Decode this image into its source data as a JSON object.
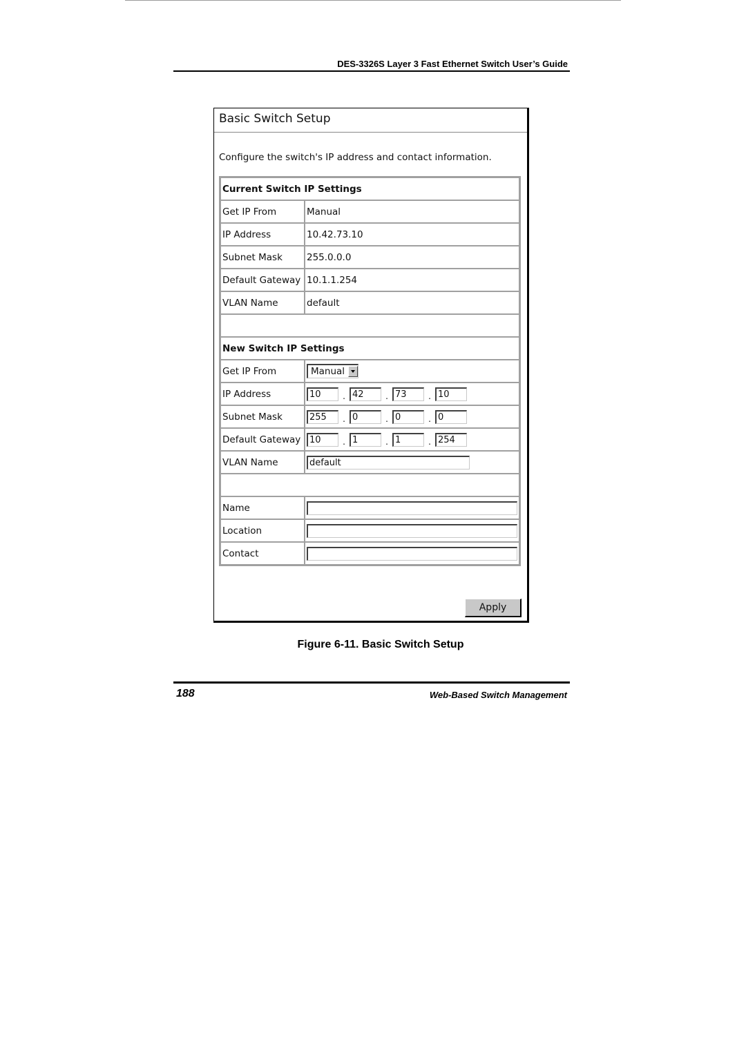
{
  "document": {
    "running_header": "DES-3326S Layer 3 Fast Ethernet Switch User’s Guide",
    "figure_caption": "Figure 6-11.  Basic Switch Setup",
    "page_number": "188",
    "footer_section": "Web-Based Switch Management"
  },
  "panel": {
    "title": "Basic Switch Setup",
    "description": "Configure the switch's IP address and contact information.",
    "current": {
      "heading": "Current Switch IP Settings",
      "rows": [
        {
          "label": "Get IP From",
          "value": "Manual"
        },
        {
          "label": "IP Address",
          "value": "10.42.73.10"
        },
        {
          "label": "Subnet Mask",
          "value": "255.0.0.0"
        },
        {
          "label": "Default Gateway",
          "value": "10.1.1.254"
        },
        {
          "label": "VLAN Name",
          "value": "default"
        }
      ]
    },
    "new": {
      "heading": "New Switch IP Settings",
      "get_ip_from": {
        "label": "Get IP From",
        "selected": "Manual"
      },
      "ip_address": {
        "label": "IP Address",
        "octets": [
          "10",
          "42",
          "73",
          "10"
        ]
      },
      "subnet_mask": {
        "label": "Subnet Mask",
        "octets": [
          "255",
          "0",
          "0",
          "0"
        ]
      },
      "default_gateway": {
        "label": "Default Gateway",
        "octets": [
          "10",
          "1",
          "1",
          "254"
        ]
      },
      "vlan_name": {
        "label": "VLAN Name",
        "value": "default"
      }
    },
    "contact": {
      "name": {
        "label": "Name",
        "value": ""
      },
      "location": {
        "label": "Location",
        "value": ""
      },
      "contact": {
        "label": "Contact",
        "value": ""
      }
    },
    "apply_label": "Apply",
    "octet_separator": "."
  }
}
